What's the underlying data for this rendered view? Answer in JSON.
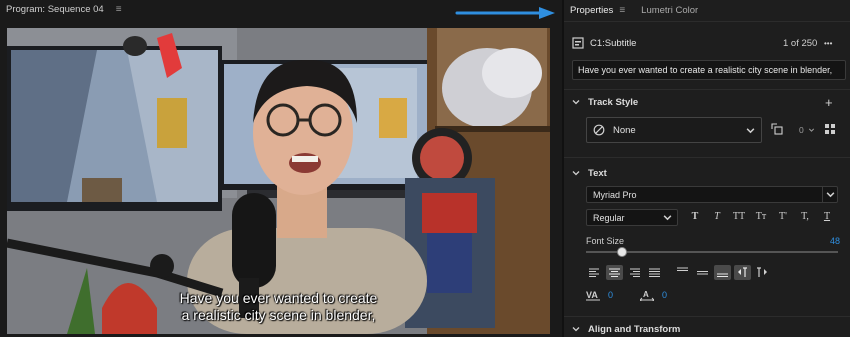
{
  "program": {
    "title": "Program: Sequence 04",
    "menu": "≡"
  },
  "subtitle": {
    "line1": "Have you ever wanted to create",
    "line2": "a realistic city scene in blender,"
  },
  "tabs": {
    "properties": "Properties",
    "menu": "≡",
    "lumetri": "Lumetri Color"
  },
  "clip": {
    "name": "C1:Subtitle",
    "count": "1 of 250",
    "more": "•••",
    "text": "Have you ever wanted to create a realistic city scene in blender,"
  },
  "track_style": {
    "header": "Track Style",
    "value": "None",
    "add": "+",
    "badge": "0"
  },
  "text_section": {
    "header": "Text",
    "font": "Myriad Pro",
    "style": "Regular",
    "type_buttons": [
      "T",
      "T",
      "TT",
      "Tт",
      "T'",
      "T,",
      "T"
    ],
    "font_size_label": "Font Size",
    "font_size_value": "48",
    "font_size_fraction": 0.13,
    "kerning": "0",
    "tracking": "0"
  },
  "align_transform": {
    "header": "Align and Transform"
  },
  "colors": {
    "accent": "#2f8fe0",
    "panel": "#1e1e1e"
  }
}
